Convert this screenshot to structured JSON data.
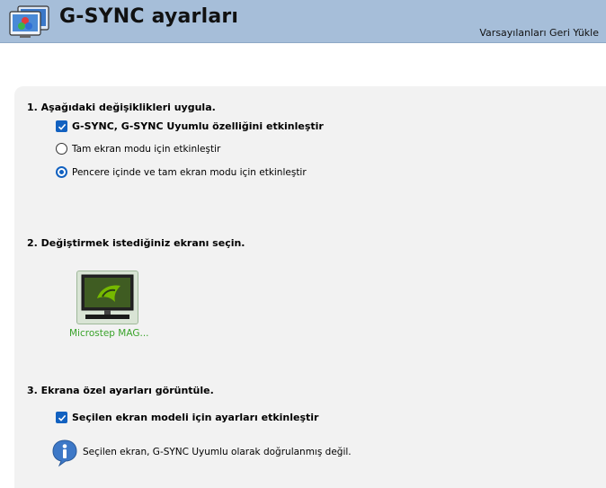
{
  "header": {
    "title": "G-SYNC ayarları",
    "restore_defaults": "Varsayılanları Geri Yükle"
  },
  "section1": {
    "title": "1. Aşağıdaki değişiklikleri uygula.",
    "enable_gsync": {
      "label": "G-SYNC, G-SYNC Uyumlu özelliğini etkinleştir",
      "checked": true
    },
    "mode_options": [
      {
        "label": "Tam ekran modu için etkinleştir",
        "selected": false
      },
      {
        "label": "Pencere içinde ve tam ekran modu için etkinleştir",
        "selected": true
      }
    ]
  },
  "section2": {
    "title": "2. Değiştirmek istediğiniz ekranı seçin.",
    "display": {
      "label": "Microstep MAG..."
    }
  },
  "section3": {
    "title": "3. Ekrana özel ayarları görüntüle.",
    "enable_model_settings": {
      "label": "Seçilen ekran modeli için ayarları etkinleştir",
      "checked": true
    },
    "info": "Seçilen ekran, G-SYNC Uyumlu olarak doğrulanmış değil."
  },
  "colors": {
    "header_bg": "#a6bed9",
    "panel_bg": "#f2f2f2",
    "accent_blue": "#1261c0",
    "display_label_green": "#3aa32b"
  }
}
